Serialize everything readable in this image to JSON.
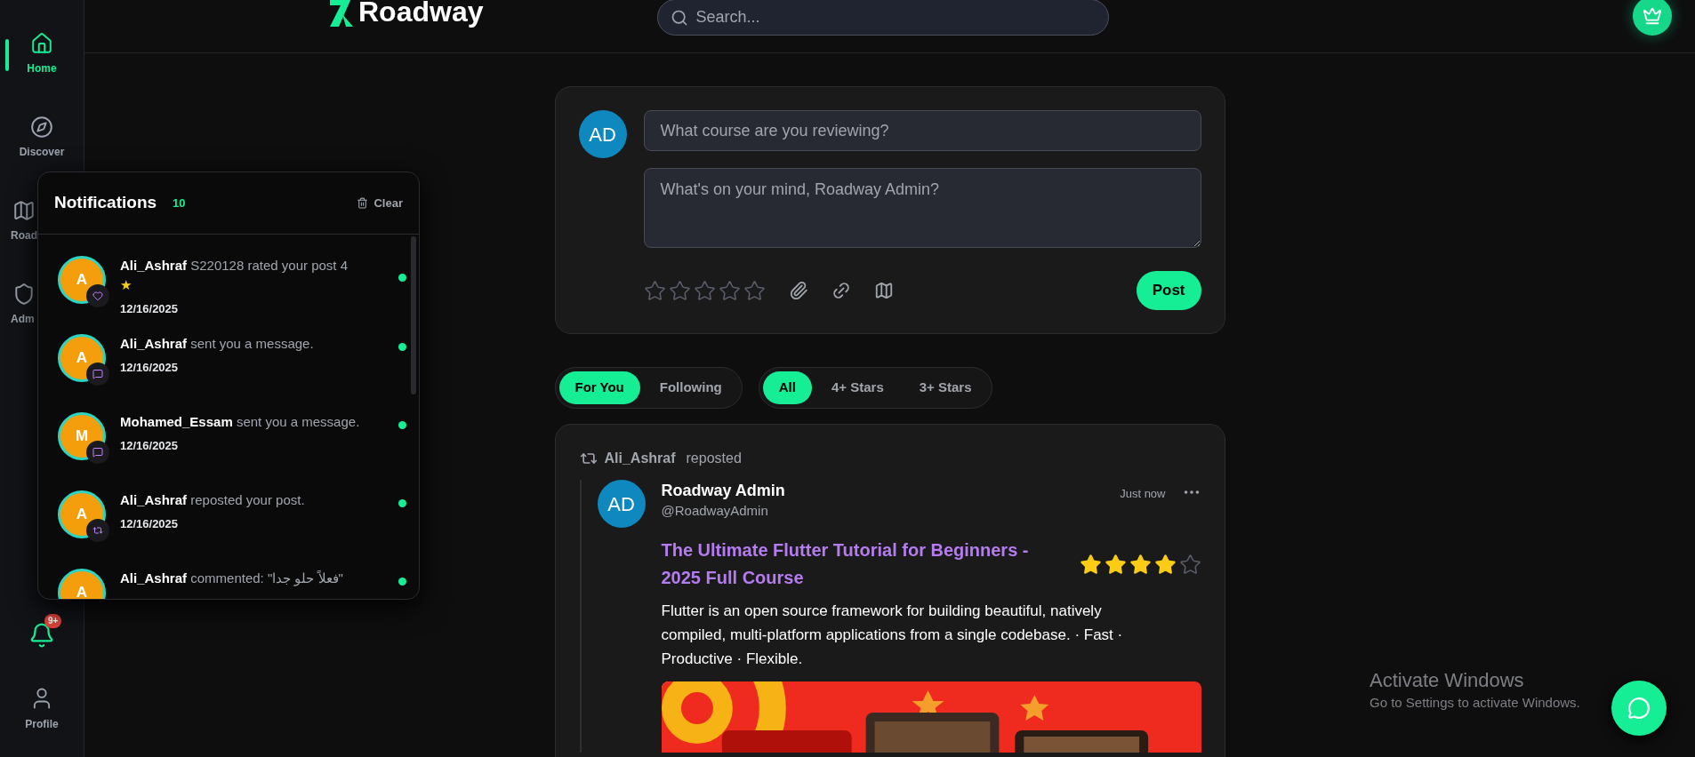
{
  "header": {
    "logo": "Roadway",
    "search": {
      "placeholder": "Search..."
    }
  },
  "sidebar": {
    "items": [
      {
        "label": "Home",
        "selected": true
      },
      {
        "label": "Discover",
        "selected": false
      },
      {
        "label": "Road",
        "selected": false
      },
      {
        "label": "Adm",
        "selected": false
      }
    ],
    "bell": {
      "badge": "9+"
    },
    "profile": {
      "label": "Profile",
      "selected": false
    }
  },
  "notifications": {
    "title": "Notifications",
    "count": "10",
    "clear": "Clear",
    "items": [
      {
        "avatar": "A",
        "name": "Ali_Ashraf",
        "text": "S220128 rated your post 4",
        "trail": "★",
        "date": "12/16/2025",
        "kind": "rating",
        "unread": true
      },
      {
        "avatar": "A",
        "name": "Ali_Ashraf",
        "text": "sent you a message.",
        "date": "12/16/2025",
        "kind": "message",
        "unread": true
      },
      {
        "avatar": "M",
        "name": "Mohamed_Essam",
        "text": "sent you a message.",
        "date": "12/16/2025",
        "kind": "message",
        "unread": true
      },
      {
        "avatar": "A",
        "name": "Ali_Ashraf",
        "text": "reposted your post.",
        "date": "12/16/2025",
        "kind": "repost",
        "unread": true
      },
      {
        "avatar": "A",
        "name": "Ali_Ashraf",
        "text": "commented: \"فعلاً حلو جدا\"",
        "unread": true
      }
    ]
  },
  "composer": {
    "avatar": "AD",
    "course": {
      "placeholder": "What course are you reviewing?"
    },
    "body": {
      "placeholder": "What's on your mind, Roadway Admin?"
    },
    "stars": 0,
    "post": "Post"
  },
  "feed_tabs": [
    {
      "label": "For You",
      "selected": true
    },
    {
      "label": "Following",
      "selected": false
    }
  ],
  "filters": [
    {
      "label": "All",
      "selected": true
    },
    {
      "label": "4+ Stars",
      "selected": false
    },
    {
      "label": "3+ Stars",
      "selected": false
    }
  ],
  "post": {
    "reposted_by": "Ali_Ashraf",
    "repost_label": "reposted",
    "avatar": "AD",
    "author": "Roadway Admin",
    "handle": "@RoadwayAdmin",
    "time": "Just now",
    "title": "The Ultimate Flutter Tutorial for Beginners - 2025 Full Course",
    "stars": 4,
    "body": "Flutter is an open source framework for building beautiful, natively compiled, multi-platform applications from a single codebase. · Fast · Productive · Flexible."
  },
  "os_notice": {
    "title": "Activate Windows",
    "text": "Go to Settings to activate Windows."
  }
}
